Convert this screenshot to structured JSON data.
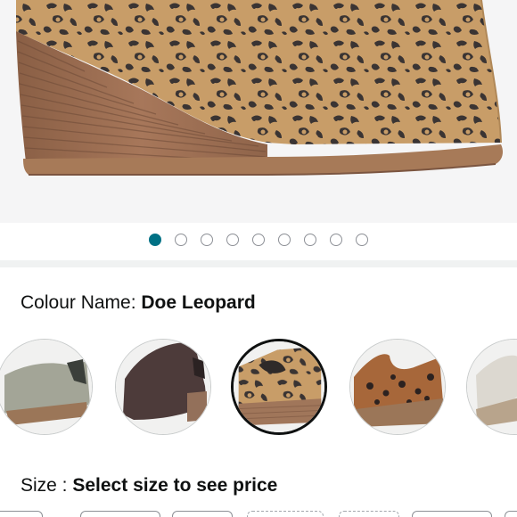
{
  "product_image": {
    "alt_icon": "leopard-wedge-bootie-image",
    "pattern": "leopard",
    "slide_count": 9,
    "active_slide": 1
  },
  "colour": {
    "label": "Colour Name: ",
    "value": "Doe Leopard",
    "swatches": [
      {
        "name": "sage-suede",
        "color": "#a3a597"
      },
      {
        "name": "chocolate-suede",
        "color": "#4d3b3a"
      },
      {
        "name": "doe-leopard",
        "color": "#c69a63",
        "selected": true
      },
      {
        "name": "tan-leopard",
        "color": "#a7673a"
      },
      {
        "name": "cream",
        "color": "#dcd8d0"
      }
    ]
  },
  "size": {
    "label": "Size : ",
    "value": "Select size to see price"
  },
  "colors": {
    "accent": "#007185",
    "text": "#0f1111",
    "selected_border": "#0f1111"
  }
}
